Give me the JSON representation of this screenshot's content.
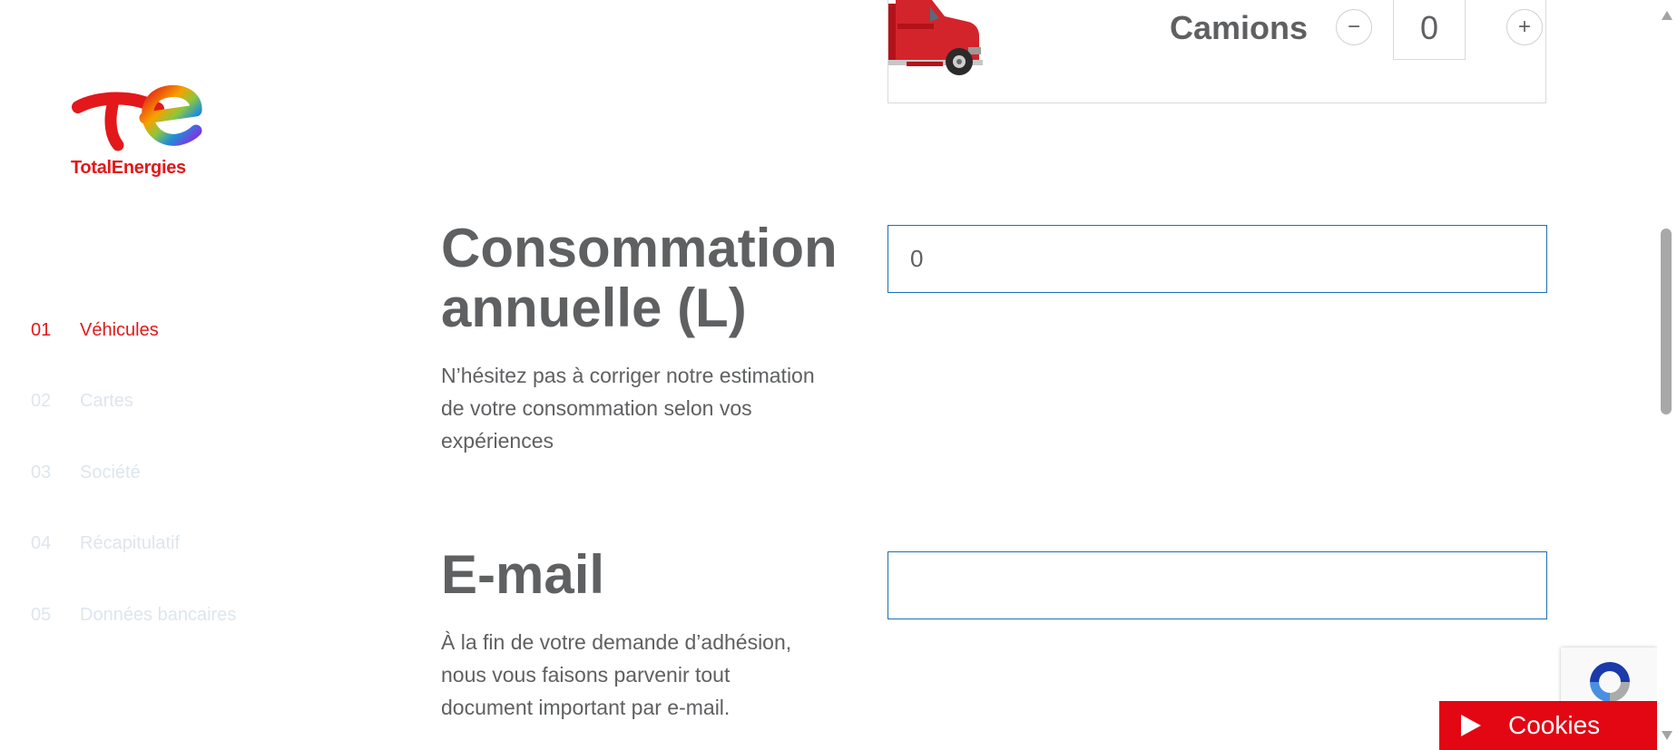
{
  "brand": {
    "name": "TotalEnergies",
    "color": "#e3181a"
  },
  "steps": [
    {
      "num": "01",
      "label": "Véhicules",
      "state": "active"
    },
    {
      "num": "02",
      "label": "Cartes",
      "state": "inactive"
    },
    {
      "num": "03",
      "label": "Société",
      "state": "inactive"
    },
    {
      "num": "04",
      "label": "Récapitulatif",
      "state": "inactive"
    },
    {
      "num": "05",
      "label": "Données bancaires",
      "state": "inactive"
    }
  ],
  "vehicle": {
    "label": "Camions",
    "count": "0",
    "minus_symbol": "−",
    "plus_symbol": "+",
    "icon": "red-truck-icon"
  },
  "consumption": {
    "title_line1": "Consommation",
    "title_line2": "annuelle (L)",
    "description": "N’hésitez pas à corriger notre estimation de votre consommation selon vos expériences",
    "value": "0"
  },
  "email": {
    "title": "E-mail",
    "description": "À la fin de votre demande d’adhésion, nous vous faisons parvenir tout document important par e-mail.",
    "value": ""
  },
  "cookies": {
    "label": "Cookies",
    "color": "#e30613"
  }
}
